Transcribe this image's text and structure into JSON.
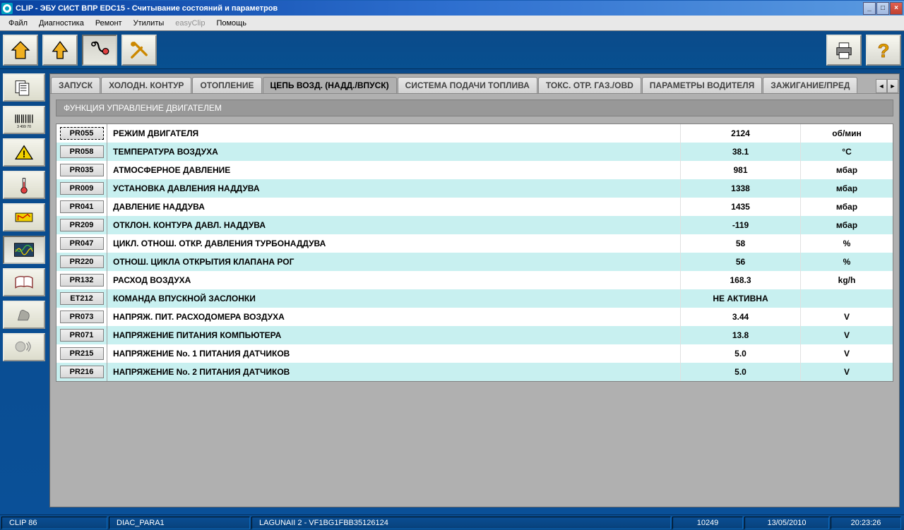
{
  "titlebar": {
    "text": "CLIP - ЭБУ СИСТ ВПР EDC15 - Считывание состояний и параметров"
  },
  "menubar": {
    "items": [
      "Файл",
      "Диагностика",
      "Ремонт",
      "Утилиты"
    ],
    "disabled": "easyClip",
    "help": "Помощь"
  },
  "tabs": [
    {
      "label": "ЗАПУСК",
      "active": false
    },
    {
      "label": "ХОЛОДН. КОНТУР",
      "active": false
    },
    {
      "label": "ОТОПЛЕНИЕ",
      "active": false
    },
    {
      "label": "ЦЕПЬ ВОЗД. (НАДД./ВПУСК)",
      "active": true
    },
    {
      "label": "СИСТЕМА ПОДАЧИ ТОПЛИВА",
      "active": false
    },
    {
      "label": "ТОКС. ОТР. ГАЗ./OBD",
      "active": false
    },
    {
      "label": "ПАРАМЕТРЫ ВОДИТЕЛЯ",
      "active": false
    },
    {
      "label": "ЗАЖИГАНИЕ/ПРЕД",
      "active": false
    }
  ],
  "section_title": "ФУНКЦИЯ УПРАВЛЕНИЕ ДВИГАТЕЛЕМ",
  "rows": [
    {
      "code": "PR055",
      "name": "РЕЖИМ ДВИГАТЕЛЯ",
      "value": "2124",
      "unit": "об/мин"
    },
    {
      "code": "PR058",
      "name": "ТЕМПЕРАТУРА ВОЗДУХА",
      "value": "38.1",
      "unit": "°C"
    },
    {
      "code": "PR035",
      "name": "АТМОСФЕРНОЕ ДАВЛЕНИЕ",
      "value": "981",
      "unit": "мбар"
    },
    {
      "code": "PR009",
      "name": "УСТАНОВКА ДАВЛЕНИЯ НАДДУВА",
      "value": "1338",
      "unit": "мбар"
    },
    {
      "code": "PR041",
      "name": "ДАВЛЕНИЕ НАДДУВА",
      "value": "1435",
      "unit": "мбар"
    },
    {
      "code": "PR209",
      "name": "ОТКЛОН. КОНТУРА ДАВЛ. НАДДУВА",
      "value": "-119",
      "unit": "мбар"
    },
    {
      "code": "PR047",
      "name": "ЦИКЛ. ОТНОШ. ОТКР. ДАВЛЕНИЯ ТУРБОНАДДУВА",
      "value": "58",
      "unit": "%"
    },
    {
      "code": "PR220",
      "name": "ОТНОШ. ЦИКЛА ОТКРЫТИЯ КЛАПАНА РОГ",
      "value": "56",
      "unit": "%"
    },
    {
      "code": "PR132",
      "name": "РАСХОД ВОЗДУХА",
      "value": "168.3",
      "unit": "kg/h"
    },
    {
      "code": "ET212",
      "name": "КОМАНДА ВПУСКНОЙ ЗАСЛОНКИ",
      "value": "НЕ АКТИВНА",
      "unit": ""
    },
    {
      "code": "PR073",
      "name": "НАПРЯЖ. ПИТ. РАСХОДОМЕРА ВОЗДУХА",
      "value": "3.44",
      "unit": "V"
    },
    {
      "code": "PR071",
      "name": "НАПРЯЖЕНИЕ ПИТАНИЯ КОМПЬЮТЕРА",
      "value": "13.8",
      "unit": "V"
    },
    {
      "code": "PR215",
      "name": "НАПРЯЖЕНИЕ No. 1 ПИТАНИЯ ДАТЧИКОВ",
      "value": "5.0",
      "unit": "V"
    },
    {
      "code": "PR216",
      "name": "НАПРЯЖЕНИЕ No. 2 ПИТАНИЯ ДАТЧИКОВ",
      "value": "5.0",
      "unit": "V"
    }
  ],
  "status": {
    "app": "CLIP 86",
    "module": "DIAC_PARA1",
    "vehicle": "LAGUNAII 2 - VF1BG1FBB35126124",
    "num": "10249",
    "date": "13/05/2010",
    "time": "20:23:26"
  }
}
